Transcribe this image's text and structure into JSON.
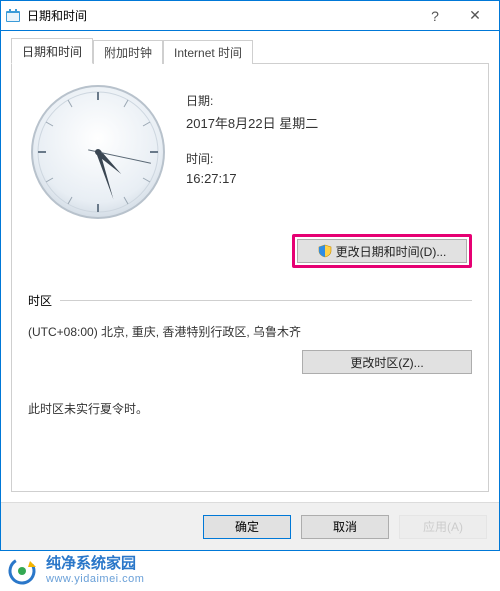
{
  "window": {
    "title": "日期和时间"
  },
  "tabs": [
    {
      "label": "日期和时间"
    },
    {
      "label": "附加时钟"
    },
    {
      "label": "Internet 时间"
    }
  ],
  "datetime": {
    "date_label": "日期:",
    "date_value": "2017年8月22日 星期二",
    "time_label": "时间:",
    "time_value": "16:27:17",
    "change_button": "更改日期和时间(D)..."
  },
  "timezone": {
    "section_label": "时区",
    "value": "(UTC+08:00) 北京, 重庆, 香港特别行政区, 乌鲁木齐",
    "change_button": "更改时区(Z)..."
  },
  "dst_note": "此时区未实行夏令时。",
  "dialog": {
    "ok": "确定",
    "cancel": "取消",
    "apply": "应用(A)"
  },
  "clock": {
    "hour": 16,
    "minute": 27,
    "second": 17
  },
  "watermark": {
    "line1": "纯净系统家园",
    "line2": "www.yidaimei.com"
  }
}
